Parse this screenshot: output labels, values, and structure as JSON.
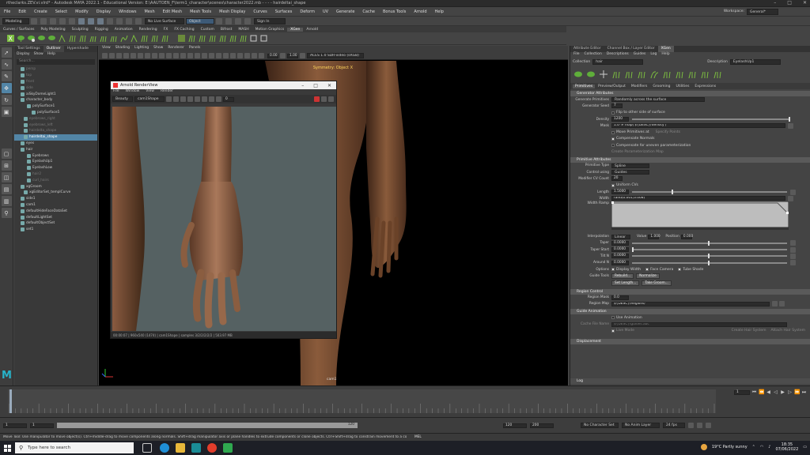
{
  "window": {
    "title": "rtheclarks.ZEV.vi.vlrd* - Autodesk MAYA 2022.1 - Educational Version: E:\\AAUTOEN_F\\term1_character\\scenes\\character2022.mb - - - - hairdeltai_shape",
    "controls": [
      "–",
      "□",
      "✕"
    ]
  },
  "menubar": [
    "File",
    "Edit",
    "Create",
    "Select",
    "Modify",
    "Display",
    "Windows",
    "Mesh",
    "Edit Mesh",
    "Mesh Tools",
    "Mesh Display",
    "Curves",
    "Surfaces",
    "Deform",
    "UV",
    "Generate",
    "Cache",
    "Bonus Tools",
    "Arnold",
    "Help"
  ],
  "workspace": {
    "label": "Workspace:",
    "value": "General*"
  },
  "statusline": {
    "mode": "Modeling",
    "surface": "No Live Surface",
    "object": "Object",
    "sign_in": "Sign In"
  },
  "shelf_tabs": [
    "Curves / Surfaces",
    "Poly Modeling",
    "Sculpting",
    "Rigging",
    "Animation",
    "Rendering",
    "FX",
    "FX Caching",
    "Custom",
    "Bifrost",
    "MASH",
    "Motion Graphics",
    "XGen",
    "Arnold"
  ],
  "shelf_active_tab": "XGen",
  "outliner": {
    "tabs": [
      "Tool Settings",
      "Outliner",
      "Hypershade"
    ],
    "menu": [
      "Display",
      "Show",
      "Help"
    ],
    "search": "Search...",
    "items": [
      {
        "label": "persp",
        "state": "dim"
      },
      {
        "label": "top",
        "state": "dim"
      },
      {
        "label": "front",
        "state": "dim"
      },
      {
        "label": "side",
        "state": "dim"
      },
      {
        "label": "aiSkyDomeLight1",
        "state": ""
      },
      {
        "label": "character_body",
        "state": ""
      },
      {
        "label": "polySurface1",
        "state": ""
      },
      {
        "label": "polySurface5",
        "state": ""
      },
      {
        "label": "eyebrows_right",
        "state": "dim"
      },
      {
        "label": "eyebrows_left",
        "state": "dim"
      },
      {
        "label": "hairdelta_shape",
        "state": "dim"
      },
      {
        "label": "hairdeltai_shape",
        "state": "sel"
      },
      {
        "label": "eyes",
        "state": ""
      },
      {
        "label": "hair",
        "state": ""
      },
      {
        "label": "Eyebrows",
        "state": ""
      },
      {
        "label": "EyelashUp1",
        "state": ""
      },
      {
        "label": "EyelashLow",
        "state": ""
      },
      {
        "label": "hair2",
        "state": "dim"
      },
      {
        "label": "curl_hairs",
        "state": "dim"
      },
      {
        "label": "xgGroom",
        "state": ""
      },
      {
        "label": "xgEditorSet_templCurve",
        "state": ""
      },
      {
        "label": "side1",
        "state": ""
      },
      {
        "label": "cam1",
        "state": ""
      },
      {
        "label": "defaultHideFaceDataSet",
        "state": ""
      },
      {
        "label": "defaultLightSet",
        "state": ""
      },
      {
        "label": "defaultObjectSet",
        "state": ""
      },
      {
        "label": "set1",
        "state": ""
      }
    ]
  },
  "viewport": {
    "menu": [
      "View",
      "Shading",
      "Lighting",
      "Show",
      "Renderer",
      "Panels"
    ],
    "values": [
      "0.00",
      "1.00"
    ],
    "colorspace": "ACES 1.0 SDR-video (sRGB)",
    "symmetry": "Symmetry: Object X",
    "camera": "cam1"
  },
  "renderview": {
    "title": "Arnold RenderView",
    "menu": [
      "File",
      "Window",
      "View",
      "Render"
    ],
    "dropdowns": [
      "Beauty",
      "cam1Shape"
    ],
    "value": "0",
    "status": "00:00:07 | 960x540 (1474) | cam1Shape | samples 3/2/2/2/2/2 | 503.97 MB"
  },
  "attr": {
    "tabs": [
      "Attribute Editor",
      "Channel Box / Layer Editor",
      "XGen"
    ],
    "menu": [
      "File",
      "Collection",
      "Descriptions",
      "Guides",
      "Log",
      "Help"
    ],
    "collection": {
      "label": "Collection",
      "value": "hair"
    },
    "description": {
      "label": "Description",
      "value": "EyelashUp1"
    },
    "subtabs": [
      "Primitives",
      "Preview/Output",
      "Modifiers",
      "Grooming",
      "Utilities",
      "Expressions"
    ],
    "sec_generator": "Generator Attributes",
    "generate_primitives": {
      "label": "Generate Primitives",
      "value": "Randomly across the surface"
    },
    "generator_seed": {
      "label": "Generator Seed",
      "value": "7"
    },
    "flip_other": "Flip to other side of surface",
    "density": {
      "label": "Density",
      "value": "1200"
    },
    "mask": {
      "label": "Mask",
      "value": "1.0*# map('${DESC}/density')"
    },
    "more_prims": "Move Primitives at",
    "specify_points": "Specify Points",
    "comp_normals": "Compensate Normals",
    "comp_uneven": "Compensate for uneven parameterization",
    "create_param_map": "Create Parameterization Map",
    "sec_primitive": "Primitive Attributes",
    "primitive_type": {
      "label": "Primitive Type",
      "value": "Spline"
    },
    "control_using": {
      "label": "Control using",
      "value": "Guides"
    },
    "modifier_cv": {
      "label": "Modifier CV Count",
      "value": "20"
    },
    "uniform_cvs": "Uniform CVs",
    "length": {
      "label": "Length",
      "value": "1.5000"
    },
    "width": {
      "label": "Width",
      "value": "rand(0.001,0.008)"
    },
    "width_ramp": "Width Ramp",
    "interp": {
      "label": "Interpolation",
      "value": "Linear"
    },
    "value_lbl": {
      "label": "Value",
      "value": "1.000"
    },
    "position_lbl": {
      "label": "Position",
      "value": "0.000"
    },
    "taper": {
      "label": "Taper",
      "value": "0.0000"
    },
    "taper_start": {
      "label": "Taper Start",
      "value": "0.0000"
    },
    "tilt_n": {
      "label": "Tilt N",
      "value": "0.0000"
    },
    "around_n": {
      "label": "Around N",
      "value": "0.0000"
    },
    "options": {
      "label": "Options",
      "items": [
        "Display Width",
        "Face Camera",
        "Tube Shade"
      ]
    },
    "guide_tools": {
      "label": "Guide Tools",
      "buttons": [
        "Rebuild...",
        "Normalize"
      ]
    },
    "guide_buttons": [
      "Set Length...",
      "Take Groom..."
    ],
    "sec_region": "Region Control",
    "region_mask": {
      "label": "Region Mask",
      "value": "0.0"
    },
    "region_map": {
      "label": "Region Map",
      "value": "${DESC}/Regions/"
    },
    "sec_guide_anim": "Guide Animation",
    "use_anim": "Use Animation",
    "cache_file": {
      "label": "Cache File Name",
      "value": "${DESC}/guides.abc"
    },
    "live_mode": "Live Mode",
    "create_hair": "Create Hair System",
    "attach_hair": "Attach Hair System",
    "sec_displacement": "Displacement",
    "log": "Log"
  },
  "timeline": {
    "current": "1",
    "range_start": "1",
    "range_end": "120",
    "start_val": "120",
    "end_val": "200",
    "char_set": "No Character Set",
    "anim_layer": "No Anim Layer",
    "fps": "24 fps"
  },
  "helpline": "Move Tool: Use manipulator to move object(s). Ctrl+middle-drag to move components along normals. Shift+drag manipulator axis or plane handles to extrude components or clone objects. Ctrl+Shift+drag to constrain movement to a connected edge. Use D or INSERT to change the p",
  "helpline_mel": "MEL",
  "taskbar": {
    "search": "Type here to search",
    "weather": "19°C  Partly sunny",
    "time": "18:35",
    "date": "07/06/2022"
  },
  "colors": {
    "accent": "#5285a6",
    "viewport_bg": "#000000",
    "skin": "#9a6a45"
  }
}
